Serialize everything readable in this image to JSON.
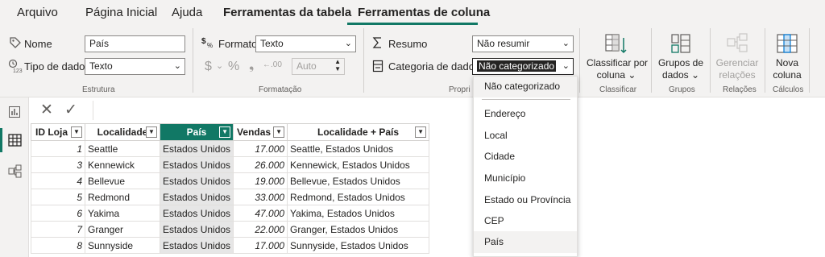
{
  "menu": {
    "tabs": [
      "Arquivo",
      "Página Inicial",
      "Ajuda",
      "Ferramentas da tabela",
      "Ferramentas de coluna"
    ]
  },
  "estrutura": {
    "nome_label": "Nome",
    "nome_value": "País",
    "tipo_label": "Tipo de dados",
    "tipo_value": "Texto",
    "group_label": "Estrutura"
  },
  "formatacao": {
    "formato_label": "Formato",
    "formato_value": "Texto",
    "currency_symbol": "$",
    "percent_symbol": "%",
    "comma_symbol": "❟",
    "decimals_symbol": "←.00",
    "auto_value": "Auto",
    "group_label": "Formatação"
  },
  "propriedades": {
    "resumo_label": "Resumo",
    "resumo_value": "Não resumir",
    "categoria_label": "Categoria de dados",
    "categoria_value": "Não categorizado",
    "group_label": "Propri"
  },
  "buttons": {
    "classificar": [
      "Classificar por",
      "coluna ⌄"
    ],
    "classificar_group": "Classificar",
    "grupos": [
      "Grupos de",
      "dados ⌄"
    ],
    "grupos_group": "Grupos",
    "gerenciar": [
      "Gerenciar",
      "relações"
    ],
    "relacoes_group": "Relações",
    "nova": [
      "Nova",
      "coluna"
    ],
    "calculos_group": "Cálculos"
  },
  "formula_bar": {
    "cancel": "✕",
    "commit": "✓"
  },
  "table": {
    "headers": [
      "ID Loja",
      "Localidade",
      "País",
      "Vendas",
      "Localidade + País"
    ],
    "rows": [
      [
        "1",
        "Seattle",
        "Estados Unidos",
        "17.000",
        "Seattle, Estados Unidos"
      ],
      [
        "3",
        "Kennewick",
        "Estados Unidos",
        "26.000",
        "Kennewick, Estados Unidos"
      ],
      [
        "4",
        "Bellevue",
        "Estados Unidos",
        "19.000",
        "Bellevue, Estados Unidos"
      ],
      [
        "5",
        "Redmond",
        "Estados Unidos",
        "33.000",
        "Redmond, Estados Unidos"
      ],
      [
        "6",
        "Yakima",
        "Estados Unidos",
        "47.000",
        "Yakima, Estados Unidos"
      ],
      [
        "7",
        "Granger",
        "Estados Unidos",
        "22.000",
        "Granger, Estados Unidos"
      ],
      [
        "8",
        "Sunnyside",
        "Estados Unidos",
        "17.000",
        "Sunnyside, Estados Unidos"
      ]
    ]
  },
  "dropdown": {
    "items": [
      "Não categorizado",
      "Endereço",
      "Local",
      "Cidade",
      "Município",
      "Estado ou Província",
      "CEP",
      "País"
    ]
  },
  "colors": {
    "accent": "#117865"
  }
}
